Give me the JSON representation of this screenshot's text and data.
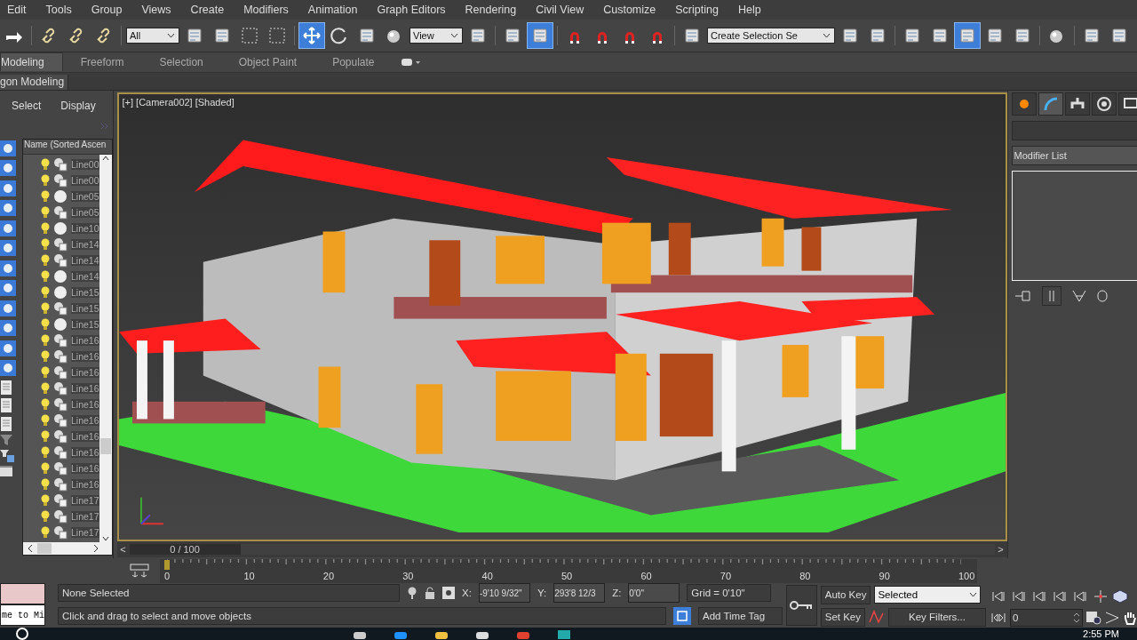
{
  "menu": [
    "Edit",
    "Tools",
    "Group",
    "Views",
    "Create",
    "Modifiers",
    "Animation",
    "Graph Editors",
    "Rendering",
    "Civil View",
    "Customize",
    "Scripting",
    "Help"
  ],
  "toolbar": [
    {
      "kind": "tool",
      "selected": false
    },
    {
      "kind": "sep"
    },
    {
      "kind": "tool",
      "selected": false
    },
    {
      "kind": "tool",
      "selected": false
    },
    {
      "kind": "tool",
      "selected": false
    },
    {
      "kind": "sep"
    },
    {
      "kind": "dropdown",
      "value": "All"
    },
    {
      "kind": "tool",
      "selected": false
    },
    {
      "kind": "tool",
      "selected": false
    },
    {
      "kind": "tool",
      "selected": false
    },
    {
      "kind": "tool",
      "selected": false
    },
    {
      "kind": "sep"
    },
    {
      "kind": "tool",
      "selected": true
    },
    {
      "kind": "tool",
      "selected": false
    },
    {
      "kind": "tool",
      "selected": false
    },
    {
      "kind": "tool",
      "selected": false
    },
    {
      "kind": "dropdown",
      "value": "View"
    },
    {
      "kind": "tool",
      "selected": false
    },
    {
      "kind": "sep"
    },
    {
      "kind": "tool",
      "selected": false
    },
    {
      "kind": "tool",
      "selected": true
    },
    {
      "kind": "sep"
    },
    {
      "kind": "tool",
      "selected": false
    },
    {
      "kind": "tool",
      "selected": false
    },
    {
      "kind": "tool",
      "selected": false
    },
    {
      "kind": "tool",
      "selected": false
    },
    {
      "kind": "sep"
    },
    {
      "kind": "tool",
      "selected": false
    },
    {
      "kind": "dropdown",
      "value": "Create Selection Se"
    },
    {
      "kind": "tool",
      "selected": false
    },
    {
      "kind": "tool",
      "selected": false
    },
    {
      "kind": "sep"
    },
    {
      "kind": "tool",
      "selected": false
    },
    {
      "kind": "tool",
      "selected": false
    },
    {
      "kind": "tool",
      "selected": true
    },
    {
      "kind": "tool",
      "selected": false
    },
    {
      "kind": "tool",
      "selected": false
    },
    {
      "kind": "sep"
    },
    {
      "kind": "tool",
      "selected": false
    },
    {
      "kind": "sep"
    },
    {
      "kind": "tool",
      "selected": false
    },
    {
      "kind": "tool",
      "selected": false
    }
  ],
  "ribbon": {
    "tabs": [
      {
        "label": "Modeling",
        "selected": true
      },
      {
        "label": "Freeform",
        "selected": false
      },
      {
        "label": "Selection",
        "selected": false
      },
      {
        "label": "Object Paint",
        "selected": false
      },
      {
        "label": "Populate",
        "selected": false
      }
    ],
    "panel": "gon Modeling"
  },
  "explorer": {
    "tabs": [
      "Select",
      "Display"
    ],
    "column": "Name (Sorted Ascen",
    "rows": [
      {
        "name": "Line00",
        "kind": "shape"
      },
      {
        "name": "Line00",
        "kind": "shape"
      },
      {
        "name": "Line05",
        "kind": "sphere"
      },
      {
        "name": "Line05",
        "kind": "shape"
      },
      {
        "name": "Line10",
        "kind": "sphere"
      },
      {
        "name": "Line14",
        "kind": "shape"
      },
      {
        "name": "Line14",
        "kind": "shape"
      },
      {
        "name": "Line14",
        "kind": "sphere"
      },
      {
        "name": "Line15",
        "kind": "sphere"
      },
      {
        "name": "Line15",
        "kind": "shape"
      },
      {
        "name": "Line15",
        "kind": "sphere"
      },
      {
        "name": "Line16",
        "kind": "shape"
      },
      {
        "name": "Line16",
        "kind": "shape"
      },
      {
        "name": "Line16",
        "kind": "shape"
      },
      {
        "name": "Line16",
        "kind": "shape"
      },
      {
        "name": "Line16",
        "kind": "shape"
      },
      {
        "name": "Line16",
        "kind": "shape"
      },
      {
        "name": "Line16",
        "kind": "shape"
      },
      {
        "name": "Line16",
        "kind": "shape"
      },
      {
        "name": "Line16",
        "kind": "shape"
      },
      {
        "name": "Line16",
        "kind": "shape"
      },
      {
        "name": "Line17",
        "kind": "shape"
      },
      {
        "name": "Line17",
        "kind": "shape"
      },
      {
        "name": "Line17",
        "kind": "shape"
      }
    ]
  },
  "viewport": {
    "labels": [
      "[+]",
      "[Camera002]",
      "[Shaded]"
    ]
  },
  "command_panel": {
    "tabs": [
      {
        "selected": false
      },
      {
        "selected": true
      },
      {
        "selected": false
      },
      {
        "selected": false
      },
      {
        "selected": false
      }
    ],
    "modifier_list": "Modifier List"
  },
  "time_slider": {
    "prev": "<",
    "position": "0 / 100",
    "next": ">",
    "level": 0
  },
  "track": {
    "labels": [
      "0",
      "10",
      "20",
      "30",
      "40",
      "50",
      "60",
      "70",
      "80",
      "90",
      "100"
    ]
  },
  "status": {
    "listener": "me to Mi",
    "selection": "None Selected",
    "prompt": "Click and drag to select and move objects",
    "x_label": "X:",
    "x": "-9'10 9/32\"",
    "y_label": "Y:",
    "z_label": "Z:",
    "y": "293'8 12/3",
    "z": "0'0\"",
    "grid": "Grid = 0'10\"",
    "time_tag": "Add Time Tag"
  },
  "animation": {
    "auto_key": "Auto Key",
    "set_key": "Set Key",
    "key_mode": "Selected",
    "key_filters": "Key Filters...",
    "frame": "0"
  },
  "taskbar": {
    "time": "2:55 PM"
  }
}
